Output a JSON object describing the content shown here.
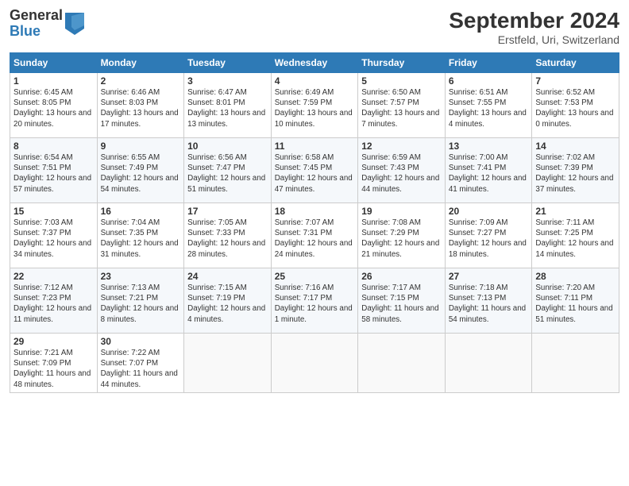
{
  "header": {
    "logo_general": "General",
    "logo_blue": "Blue",
    "title": "September 2024",
    "location": "Erstfeld, Uri, Switzerland"
  },
  "days_of_week": [
    "Sunday",
    "Monday",
    "Tuesday",
    "Wednesday",
    "Thursday",
    "Friday",
    "Saturday"
  ],
  "weeks": [
    [
      {
        "day": "1",
        "sunrise": "Sunrise: 6:45 AM",
        "sunset": "Sunset: 8:05 PM",
        "daylight": "Daylight: 13 hours and 20 minutes."
      },
      {
        "day": "2",
        "sunrise": "Sunrise: 6:46 AM",
        "sunset": "Sunset: 8:03 PM",
        "daylight": "Daylight: 13 hours and 17 minutes."
      },
      {
        "day": "3",
        "sunrise": "Sunrise: 6:47 AM",
        "sunset": "Sunset: 8:01 PM",
        "daylight": "Daylight: 13 hours and 13 minutes."
      },
      {
        "day": "4",
        "sunrise": "Sunrise: 6:49 AM",
        "sunset": "Sunset: 7:59 PM",
        "daylight": "Daylight: 13 hours and 10 minutes."
      },
      {
        "day": "5",
        "sunrise": "Sunrise: 6:50 AM",
        "sunset": "Sunset: 7:57 PM",
        "daylight": "Daylight: 13 hours and 7 minutes."
      },
      {
        "day": "6",
        "sunrise": "Sunrise: 6:51 AM",
        "sunset": "Sunset: 7:55 PM",
        "daylight": "Daylight: 13 hours and 4 minutes."
      },
      {
        "day": "7",
        "sunrise": "Sunrise: 6:52 AM",
        "sunset": "Sunset: 7:53 PM",
        "daylight": "Daylight: 13 hours and 0 minutes."
      }
    ],
    [
      {
        "day": "8",
        "sunrise": "Sunrise: 6:54 AM",
        "sunset": "Sunset: 7:51 PM",
        "daylight": "Daylight: 12 hours and 57 minutes."
      },
      {
        "day": "9",
        "sunrise": "Sunrise: 6:55 AM",
        "sunset": "Sunset: 7:49 PM",
        "daylight": "Daylight: 12 hours and 54 minutes."
      },
      {
        "day": "10",
        "sunrise": "Sunrise: 6:56 AM",
        "sunset": "Sunset: 7:47 PM",
        "daylight": "Daylight: 12 hours and 51 minutes."
      },
      {
        "day": "11",
        "sunrise": "Sunrise: 6:58 AM",
        "sunset": "Sunset: 7:45 PM",
        "daylight": "Daylight: 12 hours and 47 minutes."
      },
      {
        "day": "12",
        "sunrise": "Sunrise: 6:59 AM",
        "sunset": "Sunset: 7:43 PM",
        "daylight": "Daylight: 12 hours and 44 minutes."
      },
      {
        "day": "13",
        "sunrise": "Sunrise: 7:00 AM",
        "sunset": "Sunset: 7:41 PM",
        "daylight": "Daylight: 12 hours and 41 minutes."
      },
      {
        "day": "14",
        "sunrise": "Sunrise: 7:02 AM",
        "sunset": "Sunset: 7:39 PM",
        "daylight": "Daylight: 12 hours and 37 minutes."
      }
    ],
    [
      {
        "day": "15",
        "sunrise": "Sunrise: 7:03 AM",
        "sunset": "Sunset: 7:37 PM",
        "daylight": "Daylight: 12 hours and 34 minutes."
      },
      {
        "day": "16",
        "sunrise": "Sunrise: 7:04 AM",
        "sunset": "Sunset: 7:35 PM",
        "daylight": "Daylight: 12 hours and 31 minutes."
      },
      {
        "day": "17",
        "sunrise": "Sunrise: 7:05 AM",
        "sunset": "Sunset: 7:33 PM",
        "daylight": "Daylight: 12 hours and 28 minutes."
      },
      {
        "day": "18",
        "sunrise": "Sunrise: 7:07 AM",
        "sunset": "Sunset: 7:31 PM",
        "daylight": "Daylight: 12 hours and 24 minutes."
      },
      {
        "day": "19",
        "sunrise": "Sunrise: 7:08 AM",
        "sunset": "Sunset: 7:29 PM",
        "daylight": "Daylight: 12 hours and 21 minutes."
      },
      {
        "day": "20",
        "sunrise": "Sunrise: 7:09 AM",
        "sunset": "Sunset: 7:27 PM",
        "daylight": "Daylight: 12 hours and 18 minutes."
      },
      {
        "day": "21",
        "sunrise": "Sunrise: 7:11 AM",
        "sunset": "Sunset: 7:25 PM",
        "daylight": "Daylight: 12 hours and 14 minutes."
      }
    ],
    [
      {
        "day": "22",
        "sunrise": "Sunrise: 7:12 AM",
        "sunset": "Sunset: 7:23 PM",
        "daylight": "Daylight: 12 hours and 11 minutes."
      },
      {
        "day": "23",
        "sunrise": "Sunrise: 7:13 AM",
        "sunset": "Sunset: 7:21 PM",
        "daylight": "Daylight: 12 hours and 8 minutes."
      },
      {
        "day": "24",
        "sunrise": "Sunrise: 7:15 AM",
        "sunset": "Sunset: 7:19 PM",
        "daylight": "Daylight: 12 hours and 4 minutes."
      },
      {
        "day": "25",
        "sunrise": "Sunrise: 7:16 AM",
        "sunset": "Sunset: 7:17 PM",
        "daylight": "Daylight: 12 hours and 1 minute."
      },
      {
        "day": "26",
        "sunrise": "Sunrise: 7:17 AM",
        "sunset": "Sunset: 7:15 PM",
        "daylight": "Daylight: 11 hours and 58 minutes."
      },
      {
        "day": "27",
        "sunrise": "Sunrise: 7:18 AM",
        "sunset": "Sunset: 7:13 PM",
        "daylight": "Daylight: 11 hours and 54 minutes."
      },
      {
        "day": "28",
        "sunrise": "Sunrise: 7:20 AM",
        "sunset": "Sunset: 7:11 PM",
        "daylight": "Daylight: 11 hours and 51 minutes."
      }
    ],
    [
      {
        "day": "29",
        "sunrise": "Sunrise: 7:21 AM",
        "sunset": "Sunset: 7:09 PM",
        "daylight": "Daylight: 11 hours and 48 minutes."
      },
      {
        "day": "30",
        "sunrise": "Sunrise: 7:22 AM",
        "sunset": "Sunset: 7:07 PM",
        "daylight": "Daylight: 11 hours and 44 minutes."
      },
      null,
      null,
      null,
      null,
      null
    ]
  ]
}
